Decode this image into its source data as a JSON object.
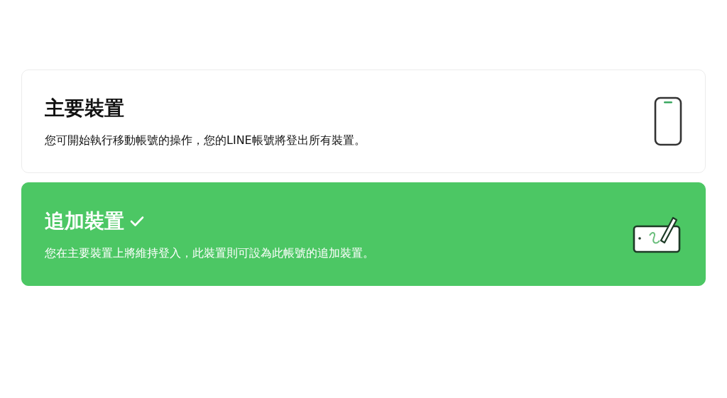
{
  "options": [
    {
      "title": "主要裝置",
      "description": "您可開始執行移動帳號的操作，您的LINE帳號將登出所有裝置。",
      "kind": "phone",
      "selected": false
    },
    {
      "title": "追加裝置",
      "description": "您在主要裝置上將維持登入，此裝置則可設為此帳號的追加裝置。",
      "kind": "tablet",
      "selected": true
    }
  ]
}
